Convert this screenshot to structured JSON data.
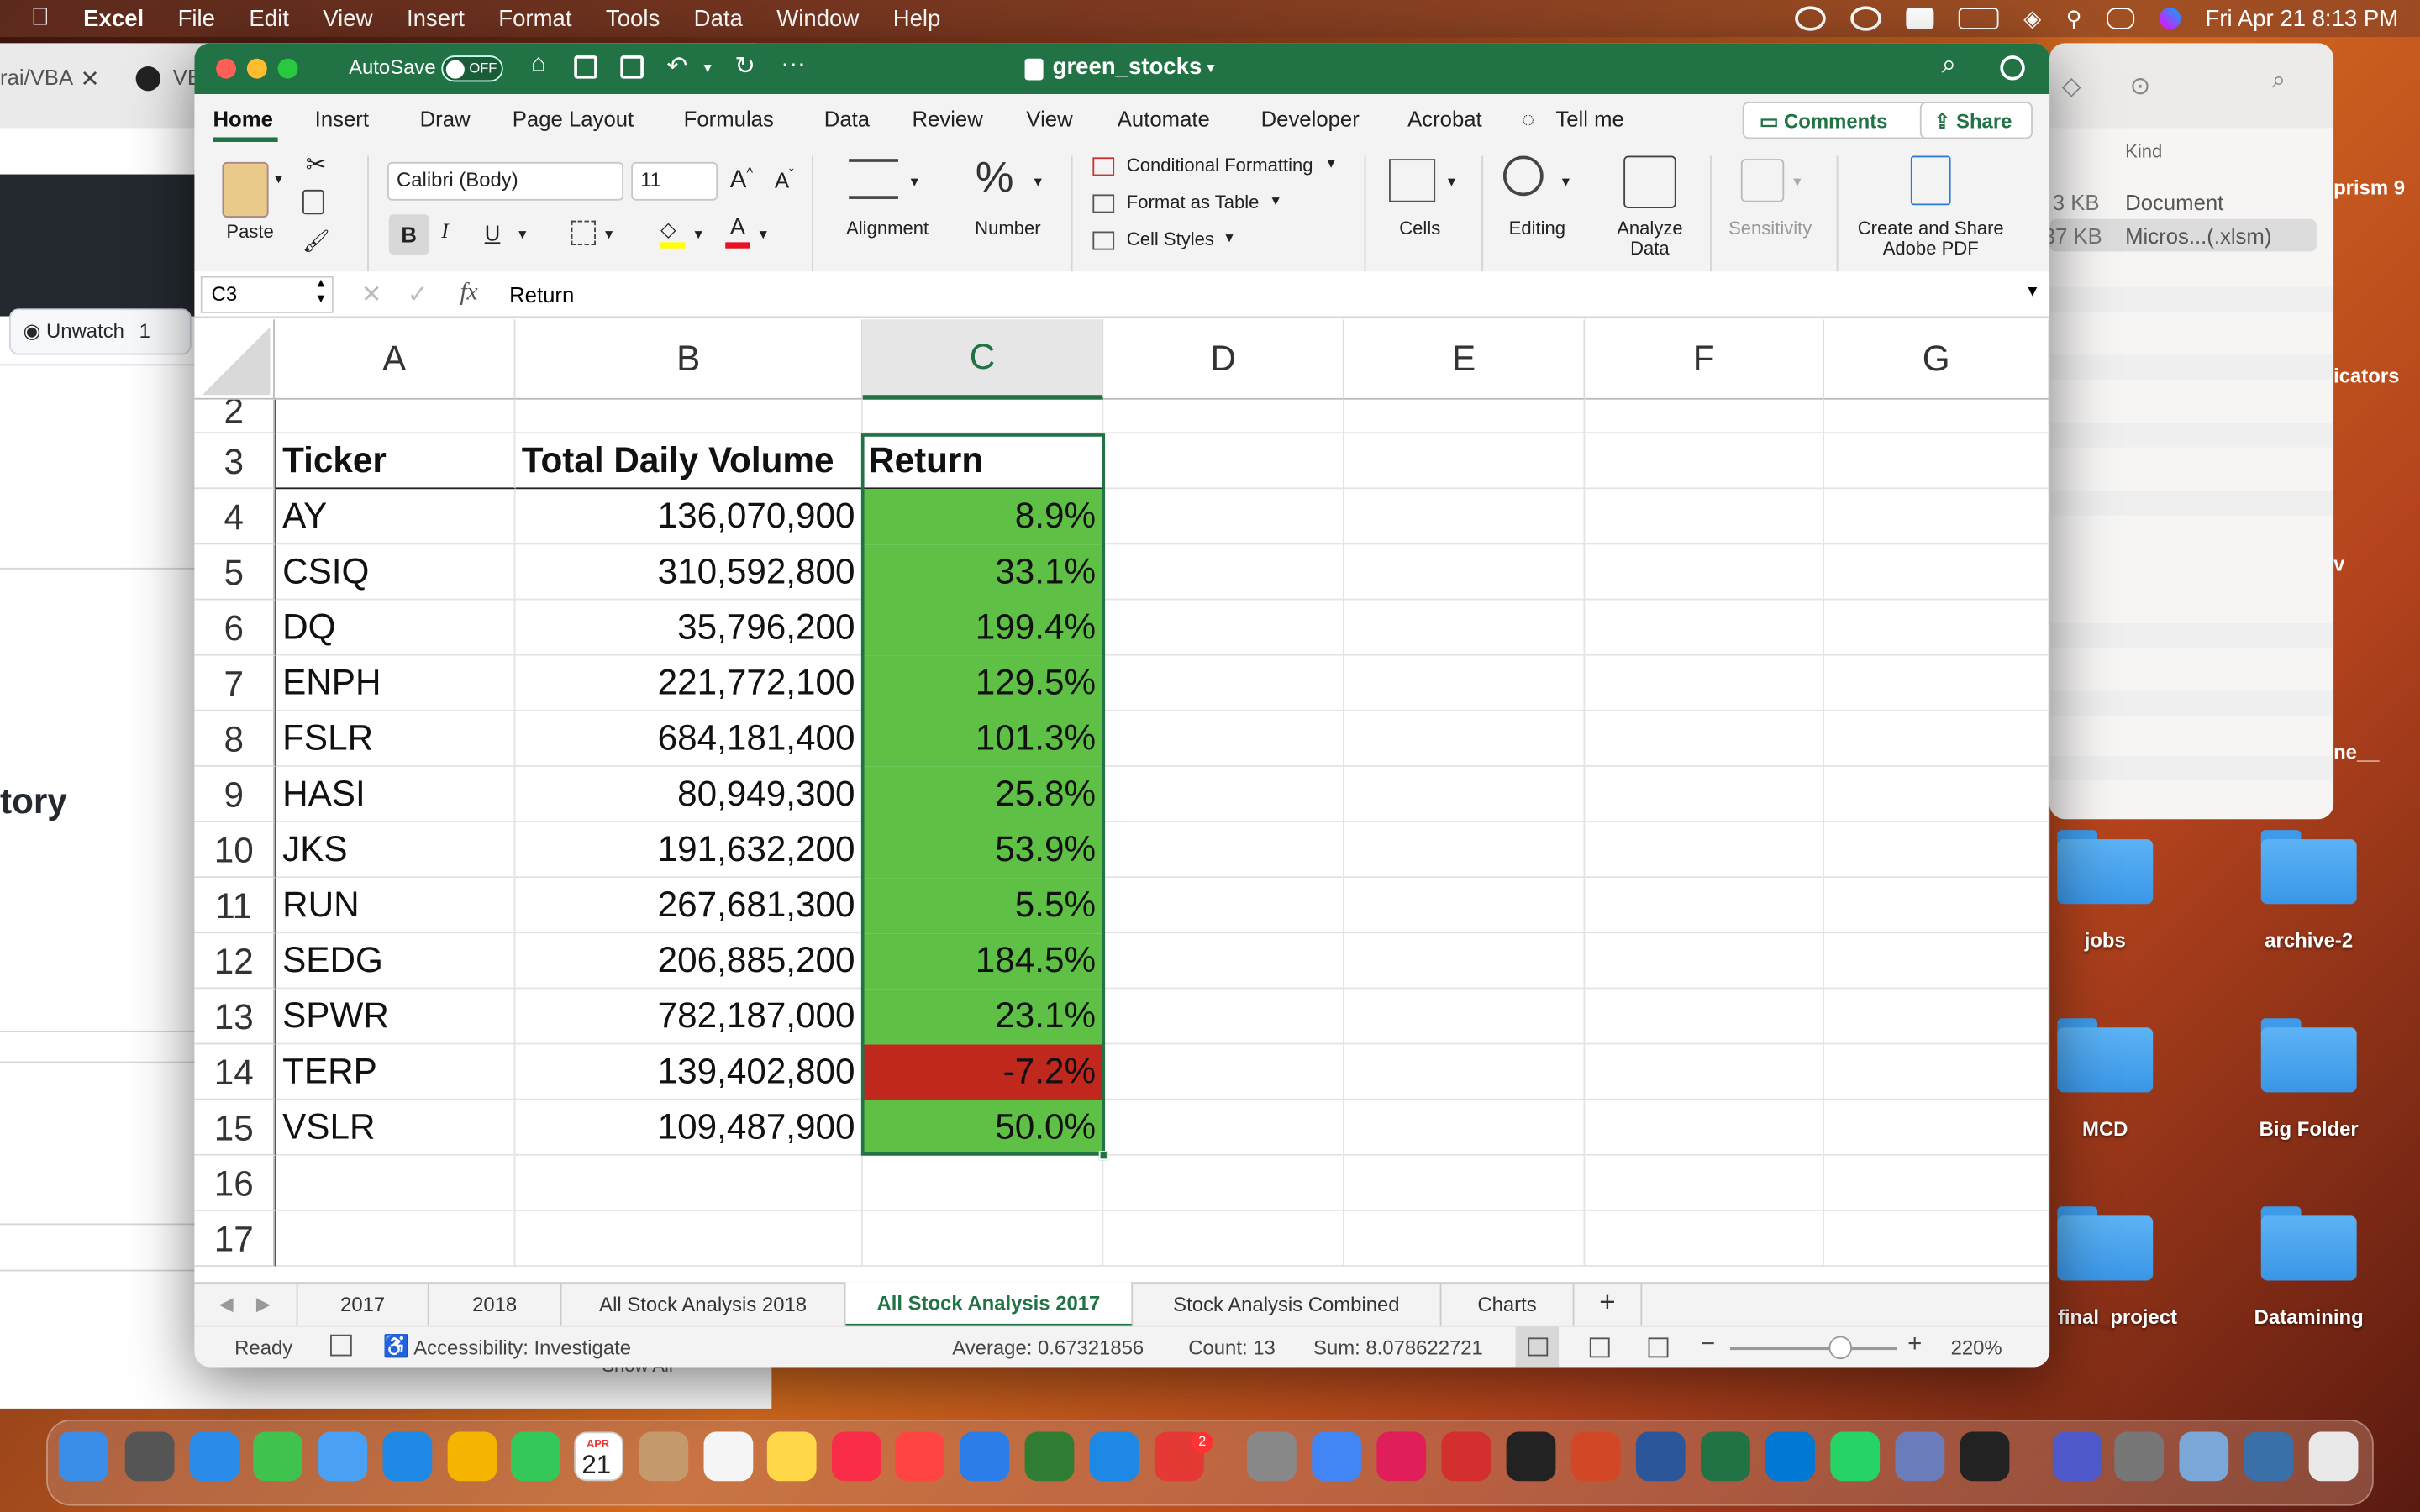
{
  "menubar": {
    "app": "Excel",
    "items": [
      "File",
      "Edit",
      "View",
      "Insert",
      "Format",
      "Tools",
      "Data",
      "Window",
      "Help"
    ],
    "clock": "Fri Apr 21  8:13 PM"
  },
  "github": {
    "tab1": "rai/VBA",
    "tab2": "VB",
    "unwatch": "Unwatch",
    "unwatch_count": "1",
    "heading": "tory",
    "show_all": "Show All"
  },
  "finder": {
    "col_kind": "Kind",
    "rows": [
      {
        "size": "3 KB",
        "kind": "Document"
      },
      {
        "size": "37 KB",
        "kind": "Micros...(.xlsm)"
      }
    ],
    "edge_labels": [
      "prism 9",
      "icators",
      "v",
      "ne__"
    ]
  },
  "desktop": {
    "folders": [
      "jobs",
      "archive-2",
      "MCD",
      "Big Folder",
      "final_project",
      "Datamining"
    ]
  },
  "excel": {
    "autosave": "AutoSave",
    "autosave_state": "OFF",
    "filename": "green_stocks",
    "tabs": [
      "Home",
      "Insert",
      "Draw",
      "Page Layout",
      "Formulas",
      "Data",
      "Review",
      "View",
      "Automate",
      "Developer",
      "Acrobat"
    ],
    "tell_me": "Tell me",
    "comments": "Comments",
    "share": "Share",
    "ribbon": {
      "paste": "Paste",
      "font": "Calibri (Body)",
      "font_size": "11",
      "bold": "B",
      "italic": "I",
      "underline": "U",
      "alignment": "Alignment",
      "number": "Number",
      "cond_format": "Conditional Formatting",
      "format_table": "Format as Table",
      "cell_styles": "Cell Styles",
      "cells": "Cells",
      "editing": "Editing",
      "analyze1": "Analyze",
      "analyze2": "Data",
      "sensitivity": "Sensitivity",
      "adobe1": "Create and Share",
      "adobe2": "Adobe PDF"
    },
    "name_box": "C3",
    "fx": "fx",
    "formula": "Return",
    "columns": [
      "A",
      "B",
      "C",
      "D",
      "E",
      "F",
      "G"
    ],
    "rows": [
      {
        "n": "2",
        "a": "",
        "b": "",
        "c": ""
      },
      {
        "n": "3",
        "a": "Ticker",
        "b": "Total Daily Volume",
        "c": "Return"
      },
      {
        "n": "4",
        "a": "AY",
        "b": "136,070,900",
        "c": "8.9%"
      },
      {
        "n": "5",
        "a": "CSIQ",
        "b": "310,592,800",
        "c": "33.1%"
      },
      {
        "n": "6",
        "a": "DQ",
        "b": "35,796,200",
        "c": "199.4%"
      },
      {
        "n": "7",
        "a": "ENPH",
        "b": "221,772,100",
        "c": "129.5%"
      },
      {
        "n": "8",
        "a": "FSLR",
        "b": "684,181,400",
        "c": "101.3%"
      },
      {
        "n": "9",
        "a": "HASI",
        "b": "80,949,300",
        "c": "25.8%"
      },
      {
        "n": "10",
        "a": "JKS",
        "b": "191,632,200",
        "c": "53.9%"
      },
      {
        "n": "11",
        "a": "RUN",
        "b": "267,681,300",
        "c": "5.5%"
      },
      {
        "n": "12",
        "a": "SEDG",
        "b": "206,885,200",
        "c": "184.5%"
      },
      {
        "n": "13",
        "a": "SPWR",
        "b": "782,187,000",
        "c": "23.1%"
      },
      {
        "n": "14",
        "a": "TERP",
        "b": "139,402,800",
        "c": "-7.2%"
      },
      {
        "n": "15",
        "a": "VSLR",
        "b": "109,487,900",
        "c": "50.0%"
      },
      {
        "n": "16",
        "a": "",
        "b": "",
        "c": ""
      },
      {
        "n": "17",
        "a": "",
        "b": "",
        "c": ""
      }
    ],
    "colors": {
      "positive": "#5ec145",
      "negative": "#c0281e",
      "excel_green": "#217346"
    },
    "sheets": [
      "2017",
      "2018",
      "All Stock Analysis 2018",
      "All Stock Analysis 2017",
      "Stock Analysis Combined",
      "Charts"
    ],
    "active_sheet": "All Stock Analysis 2017",
    "status": {
      "ready": "Ready",
      "accessibility": "Accessibility: Investigate",
      "average": "Average: 0.67321856",
      "count": "Count: 13",
      "sum": "Sum: 8.078622721",
      "zoom": "220%"
    }
  },
  "dock": {
    "calendar_month": "APR",
    "calendar_day": "21",
    "badge": "2"
  }
}
